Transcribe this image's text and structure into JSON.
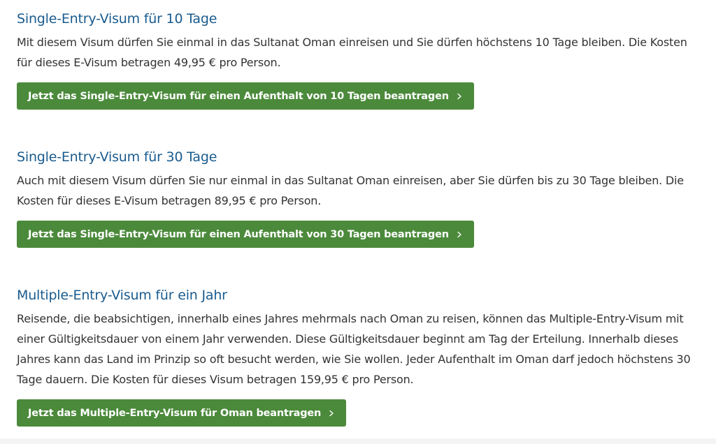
{
  "sections": [
    {
      "heading": "Single-Entry-Visum für 10 Tage",
      "text": "Mit diesem Visum dürfen Sie einmal in das Sultanat Oman einreisen und Sie dürfen höchstens 10 Tage bleiben. Die Kosten für dieses E-Visum betragen 49,95 € pro Person.",
      "button_label": "Jetzt das Single-Entry-Visum für einen Aufenthalt von 10 Tagen beantragen",
      "button_icon": "chevron-right-icon"
    },
    {
      "heading": "Single-Entry-Visum für 30 Tage",
      "text": "Auch mit diesem Visum dürfen Sie nur einmal in das Sultanat Oman einreisen, aber Sie dürfen bis zu 30 Tage bleiben. Die Kosten für dieses E-Visum betragen 89,95 € pro Person.",
      "button_label": "Jetzt das Single-Entry-Visum für einen Aufenthalt von 30 Tagen beantragen",
      "button_icon": "chevron-right-icon"
    },
    {
      "heading": "Multiple-Entry-Visum für ein Jahr",
      "text": "Reisende, die beabsichtigen, innerhalb eines Jahres mehrmals nach Oman zu reisen, können das Multiple-Entry-Visum mit einer Gültigkeitsdauer von einem Jahr verwenden. Diese Gültigkeitsdauer beginnt am Tag der Erteilung. Innerhalb dieses Jahres kann das Land im Prinzip so oft besucht werden, wie Sie wollen. Jeder Aufenthalt im Oman darf jedoch höchstens 30 Tage dauern. Die Kosten für dieses Visum betragen 159,95 € pro Person.",
      "button_label": "Jetzt das Multiple-Entry-Visum für Oman beantragen",
      "button_icon": "chevron-right-icon"
    }
  ],
  "colors": {
    "heading": "#1a5b8e",
    "body_text": "#333333",
    "button_bg": "#4b8a3b",
    "button_text": "#ffffff",
    "background": "#ffffff"
  }
}
